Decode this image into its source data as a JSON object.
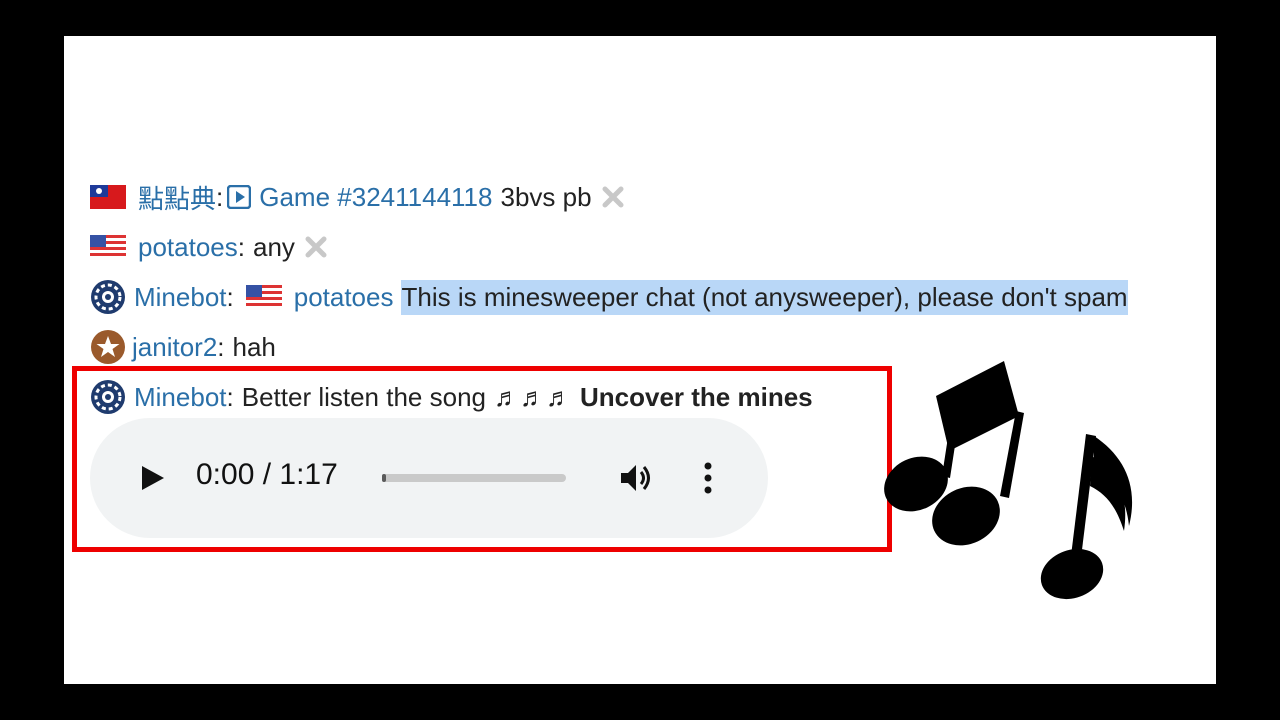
{
  "chat": {
    "line1": {
      "user": "點點典",
      "colon": ":",
      "link": "Game #3241144118",
      "text": "3bvs pb"
    },
    "line2": {
      "user": "potatoes",
      "colon": ":",
      "text": "any"
    },
    "line3": {
      "user": "Minebot",
      "colon": ":",
      "mention": "potatoes",
      "highlight": "This is minesweeper chat (not anysweeper), please don't spam"
    },
    "line4": {
      "user": "janitor2",
      "colon": ":",
      "text": "hah"
    },
    "line5": {
      "user": "Minebot",
      "colon": ":",
      "text": "Better listen the song",
      "notes": "♬♬♬",
      "bold": "Uncover the mines"
    }
  },
  "player": {
    "time": "0:00 / 1:17",
    "progress": 0.02
  },
  "colors": {
    "link": "#2a6fa8",
    "highlight": "#b9d7f7",
    "box": "#ee0000",
    "player_bg": "#f1f3f4"
  },
  "icons": [
    "taiwan-flag-icon",
    "us-flag-icon",
    "gear-badge-icon",
    "star-badge-icon",
    "play-square-icon",
    "close-icon",
    "play-icon",
    "volume-icon",
    "more-vert-icon",
    "music-notes-icon"
  ]
}
